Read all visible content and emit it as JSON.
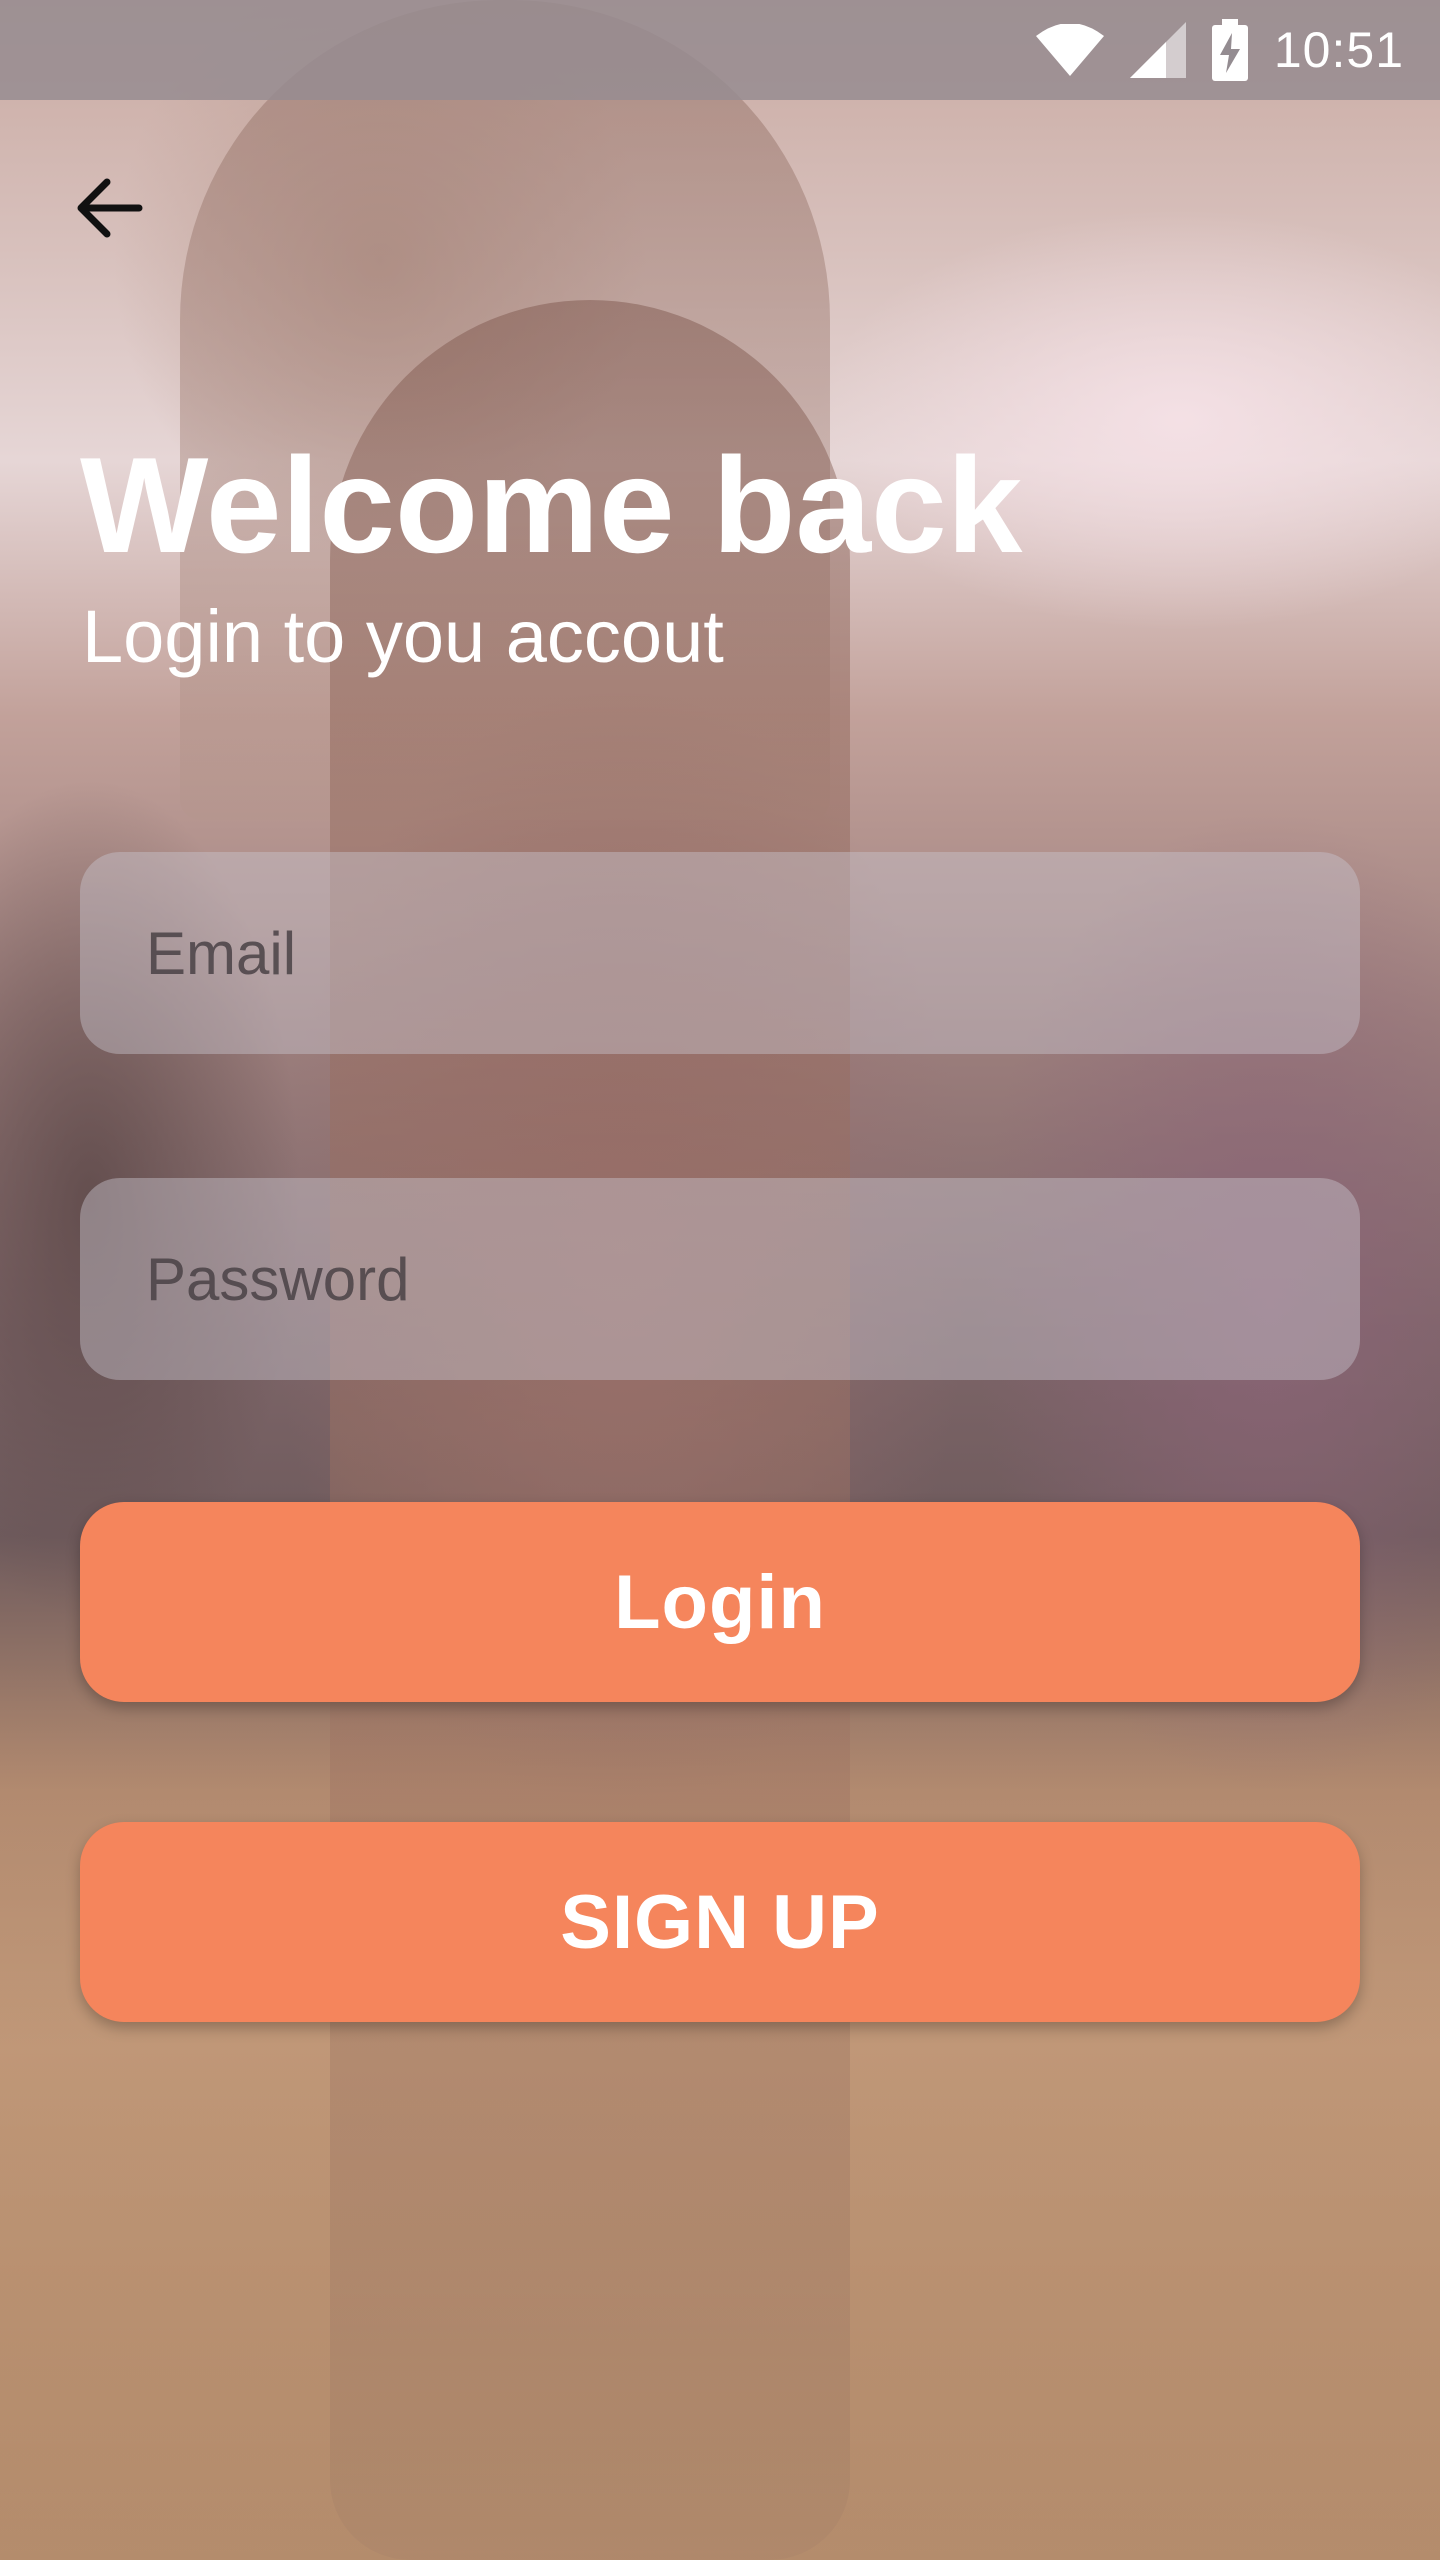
{
  "status_bar": {
    "time": "10:51",
    "icons": [
      "wifi-icon",
      "signal-icon",
      "battery-charging-icon"
    ]
  },
  "header": {
    "back_icon": "arrow-left-icon"
  },
  "main": {
    "title": "Welcome back",
    "subtitle": "Login to you accout",
    "email_placeholder": "Email",
    "email_value": "",
    "password_placeholder": "Password",
    "password_value": "",
    "login_label": "Login",
    "signup_label": "SIGN UP"
  },
  "colors": {
    "accent": "#f5855c",
    "text": "#ffffff"
  }
}
